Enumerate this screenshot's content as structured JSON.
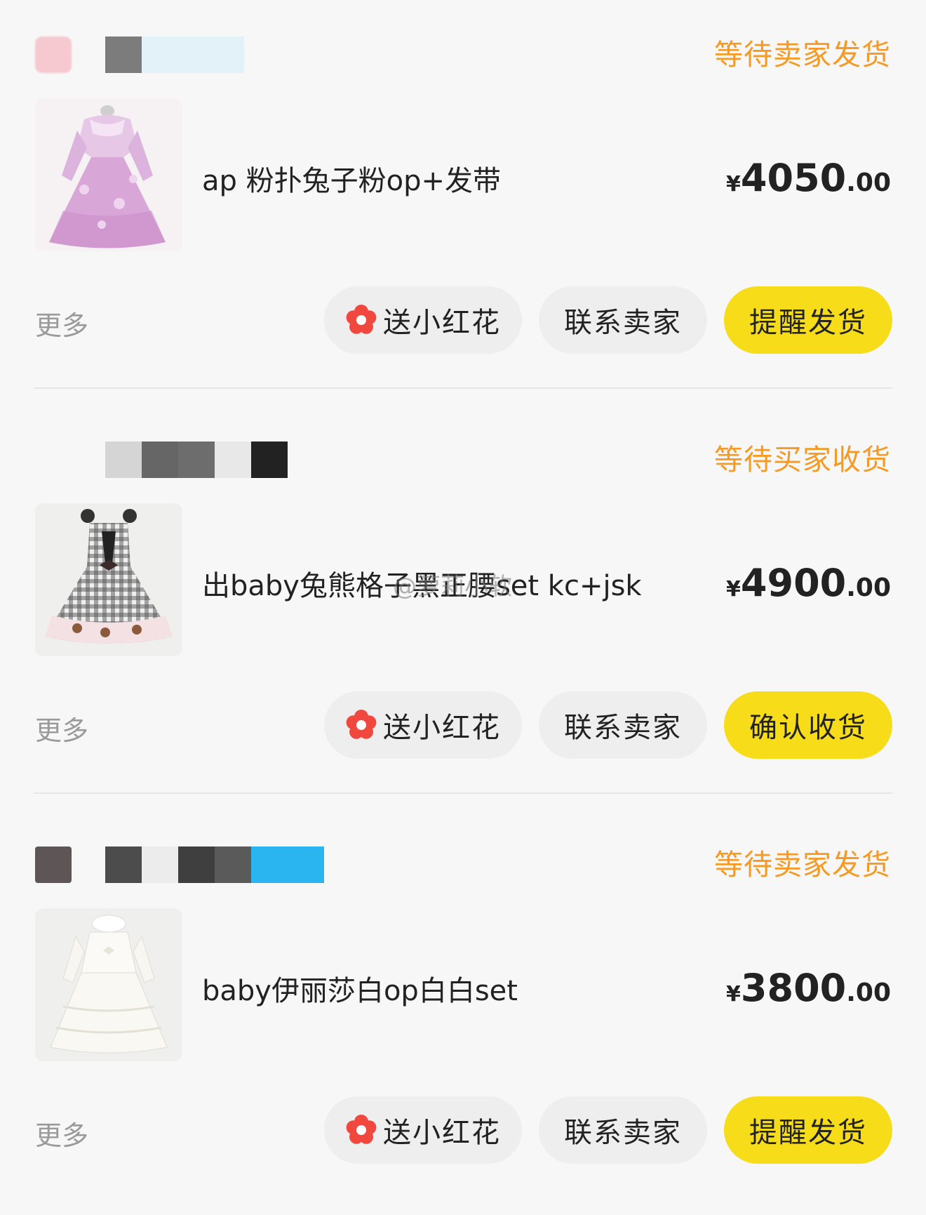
{
  "orders": [
    {
      "status": "等待卖家发货",
      "title": "ap 粉扑兔子粉op+发带",
      "price_currency": "¥",
      "price_int": "4050",
      "price_dec": ".00",
      "more": "更多",
      "flower_button": "送小红花",
      "contact_button": "联系卖家",
      "primary_button": "提醒发货"
    },
    {
      "status": "等待买家收货",
      "title": "出baby兔熊格子黑正腰set kc+jsk",
      "price_currency": "¥",
      "price_int": "4900",
      "price_dec": ".00",
      "more": "更多",
      "flower_button": "送小红花",
      "contact_button": "联系卖家",
      "primary_button": "确认收货"
    },
    {
      "status": "等待卖家发货",
      "title": "baby伊丽莎白op白白set",
      "price_currency": "¥",
      "price_int": "3800",
      "price_dec": ".00",
      "more": "更多",
      "flower_button": "送小红花",
      "contact_button": "联系卖家",
      "primary_button": "提醒发货"
    }
  ],
  "watermark": "@萝莉小软",
  "colors": {
    "status": "#f59a23",
    "primary_button": "#f7dc1a",
    "secondary_button": "#eeeeee",
    "flower": "#f0483e"
  }
}
